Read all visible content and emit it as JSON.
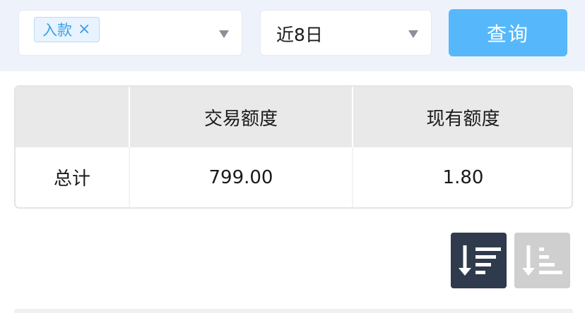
{
  "filters": {
    "type_tag": "入款",
    "type_tag_close": "×",
    "date_range": "近8日",
    "query_label": "查询"
  },
  "summary": {
    "headers": [
      "",
      "交易额度",
      "现有额度"
    ],
    "row_label": "总计",
    "transaction_amount": "799.00",
    "current_amount": "1.80"
  },
  "sort": {
    "descending_icon": "sort-descending-icon",
    "ascending_icon": "sort-ascending-icon",
    "active": "descending"
  },
  "colors": {
    "accent": "#56b8fb",
    "tag_text": "#3aa0e4",
    "sort_active": "#2f3a4d",
    "sort_inactive": "#cfcfcf",
    "filter_bg": "#eef3fb"
  }
}
